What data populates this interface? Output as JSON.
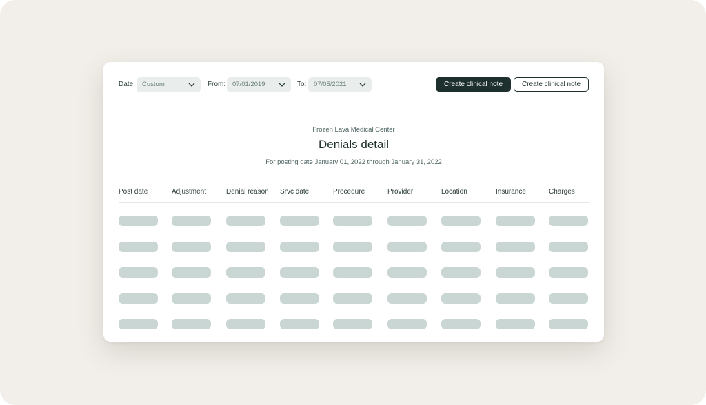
{
  "filters": {
    "date_label": "Date:",
    "date_value": "Custom",
    "from_label": "From:",
    "from_value": "07/01/2019",
    "to_label": "To:",
    "to_value": "07/05/2021"
  },
  "actions": {
    "primary_label": "Create clinical note",
    "secondary_label": "Create clinical note"
  },
  "report": {
    "organization": "Frozen Lava Medical Center",
    "title": "Denials detail",
    "subtitle": "For posting date January 01, 2022 through January 31, 2022"
  },
  "table": {
    "columns": [
      "Post date",
      "Adjustment",
      "Denial reason",
      "Srvc date",
      "Procedure",
      "Provider",
      "Location",
      "Insurance",
      "Charges"
    ],
    "rows_loading": 5
  },
  "icons": {
    "dropdown": "chevron-down-icon"
  },
  "colors": {
    "background": "#f2efea",
    "primary": "#1e302e",
    "skeleton": "#c9d6d3",
    "field": "#e9eeec"
  }
}
